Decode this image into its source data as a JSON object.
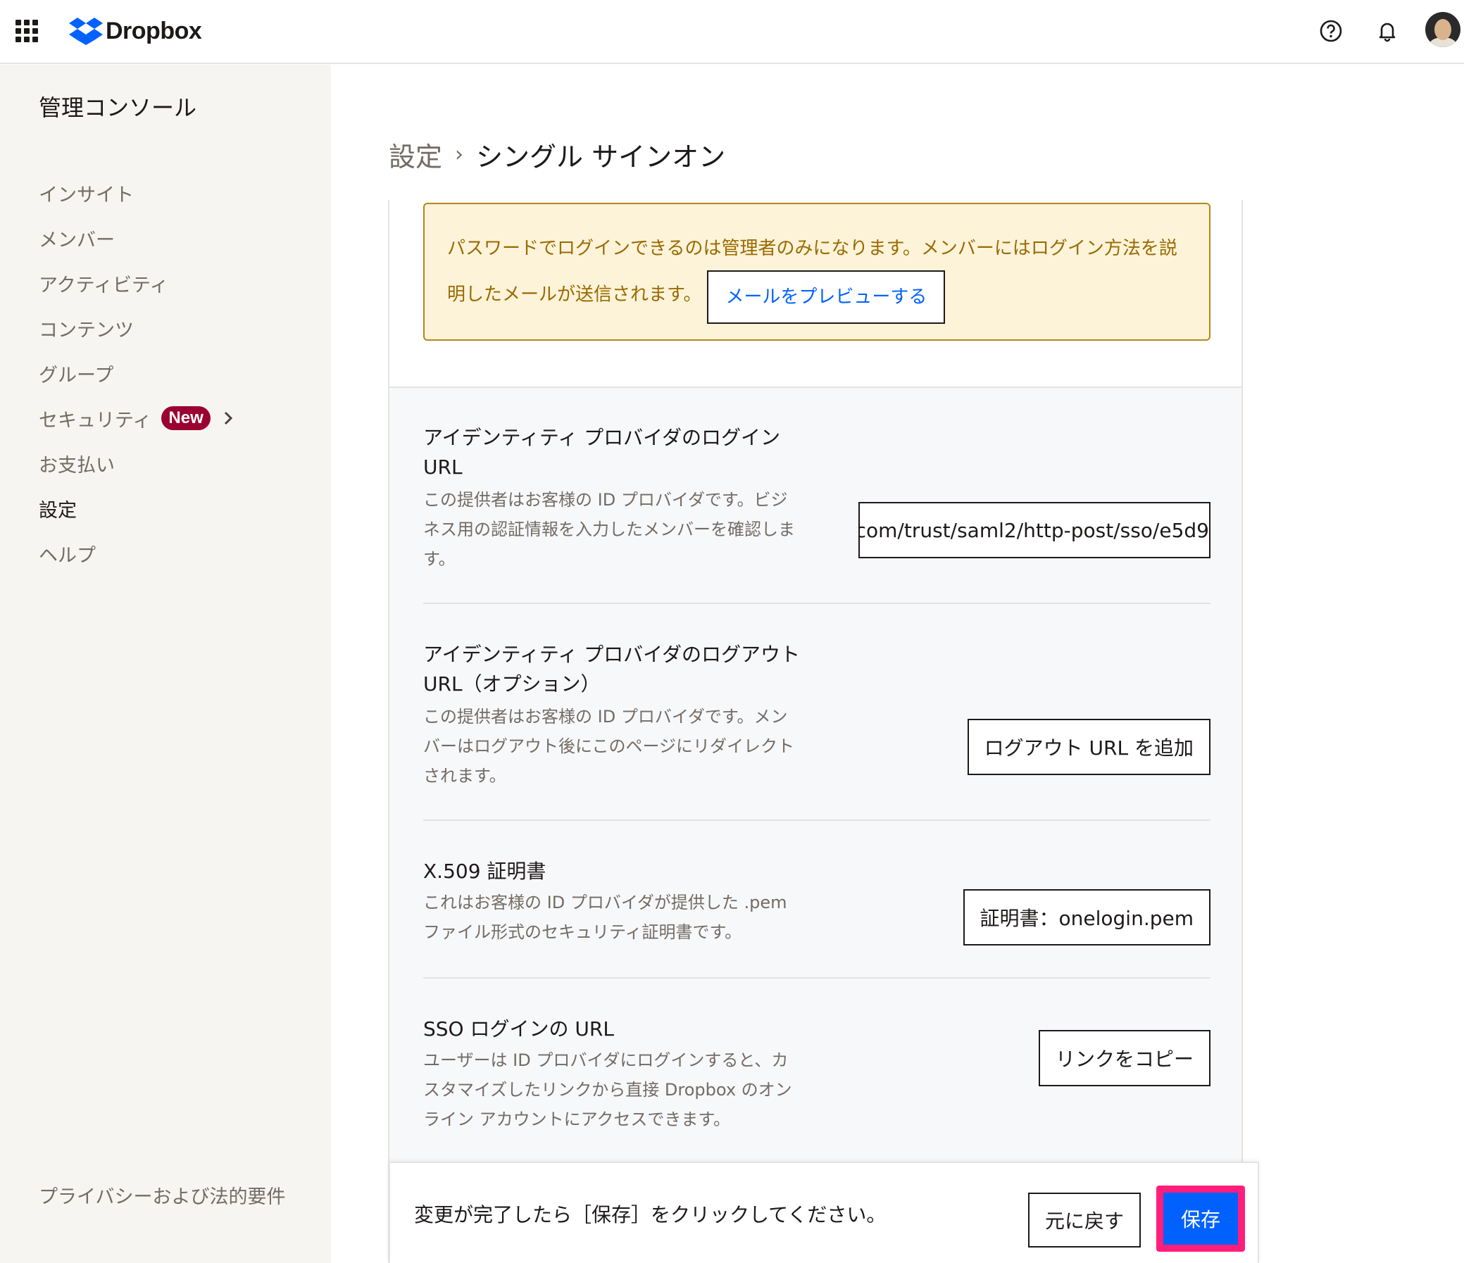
{
  "topbar": {
    "brand_name": "Dropbox",
    "apps_icon": "grid-icon",
    "help_icon": "help-circle-icon",
    "notifications_icon": "bell-icon",
    "avatar_icon": "user-avatar"
  },
  "sidebar": {
    "title": "管理コンソール",
    "items": [
      {
        "label": "インサイト",
        "active": false
      },
      {
        "label": "メンバー",
        "active": false
      },
      {
        "label": "アクティビティ",
        "active": false
      },
      {
        "label": "コンテンツ",
        "active": false
      },
      {
        "label": "グループ",
        "active": false
      },
      {
        "label": "セキュリティ",
        "active": false,
        "badge": "New"
      },
      {
        "label": "お支払い",
        "active": false
      },
      {
        "label": "設定",
        "active": true
      },
      {
        "label": "ヘルプ",
        "active": false
      }
    ],
    "footer_link": "プライバシーおよび法的要件"
  },
  "breadcrumb": {
    "parent": "設定",
    "separator": "›",
    "current": "シングル サインオン"
  },
  "notice": {
    "text": "パスワードでログインできるのは管理者のみになります。メンバーにはログイン方法を説明したメールが送信されます。",
    "preview_button": "メールをプレビューする"
  },
  "settings": {
    "idp_login": {
      "title": "アイデンティティ プロバイダのログイン URL",
      "description": "この提供者はお客様の ID プロバイダです。ビジネス用の認証情報を入力したメンバーを確認します。",
      "value": "com/trust/saml2/http-post/sso/e5d9"
    },
    "idp_logout": {
      "title": "アイデンティティ プロバイダのログアウト URL（オプション）",
      "description": "この提供者はお客様の ID プロバイダです。メンバーはログアウト後にこのページにリダイレクトされます。",
      "button": "ログアウト URL を追加"
    },
    "certificate": {
      "title": "X.509 証明書",
      "description": "これはお客様の ID プロバイダが提供した .pem ファイル形式のセキュリティ証明書です。",
      "button": "証明書：onelogin.pem"
    },
    "sso_login_url": {
      "title": "SSO ログインの URL",
      "description": "ユーザーは ID プロバイダにログインすると、カスタマイズしたリンクから直接 Dropbox のオンライン アカウントにアクセスできます。",
      "button": "リンクをコピー"
    }
  },
  "savebar": {
    "message": "変更が完了したら［保存］をクリックしてください。",
    "revert_button": "元に戻す",
    "save_button": "保存"
  },
  "colors": {
    "brand_blue": "#0061fe",
    "badge_red": "#9b0032",
    "notice_bg": "#fcf3d9",
    "notice_border": "#b4871a",
    "highlight_pink": "#ff1f7a"
  }
}
